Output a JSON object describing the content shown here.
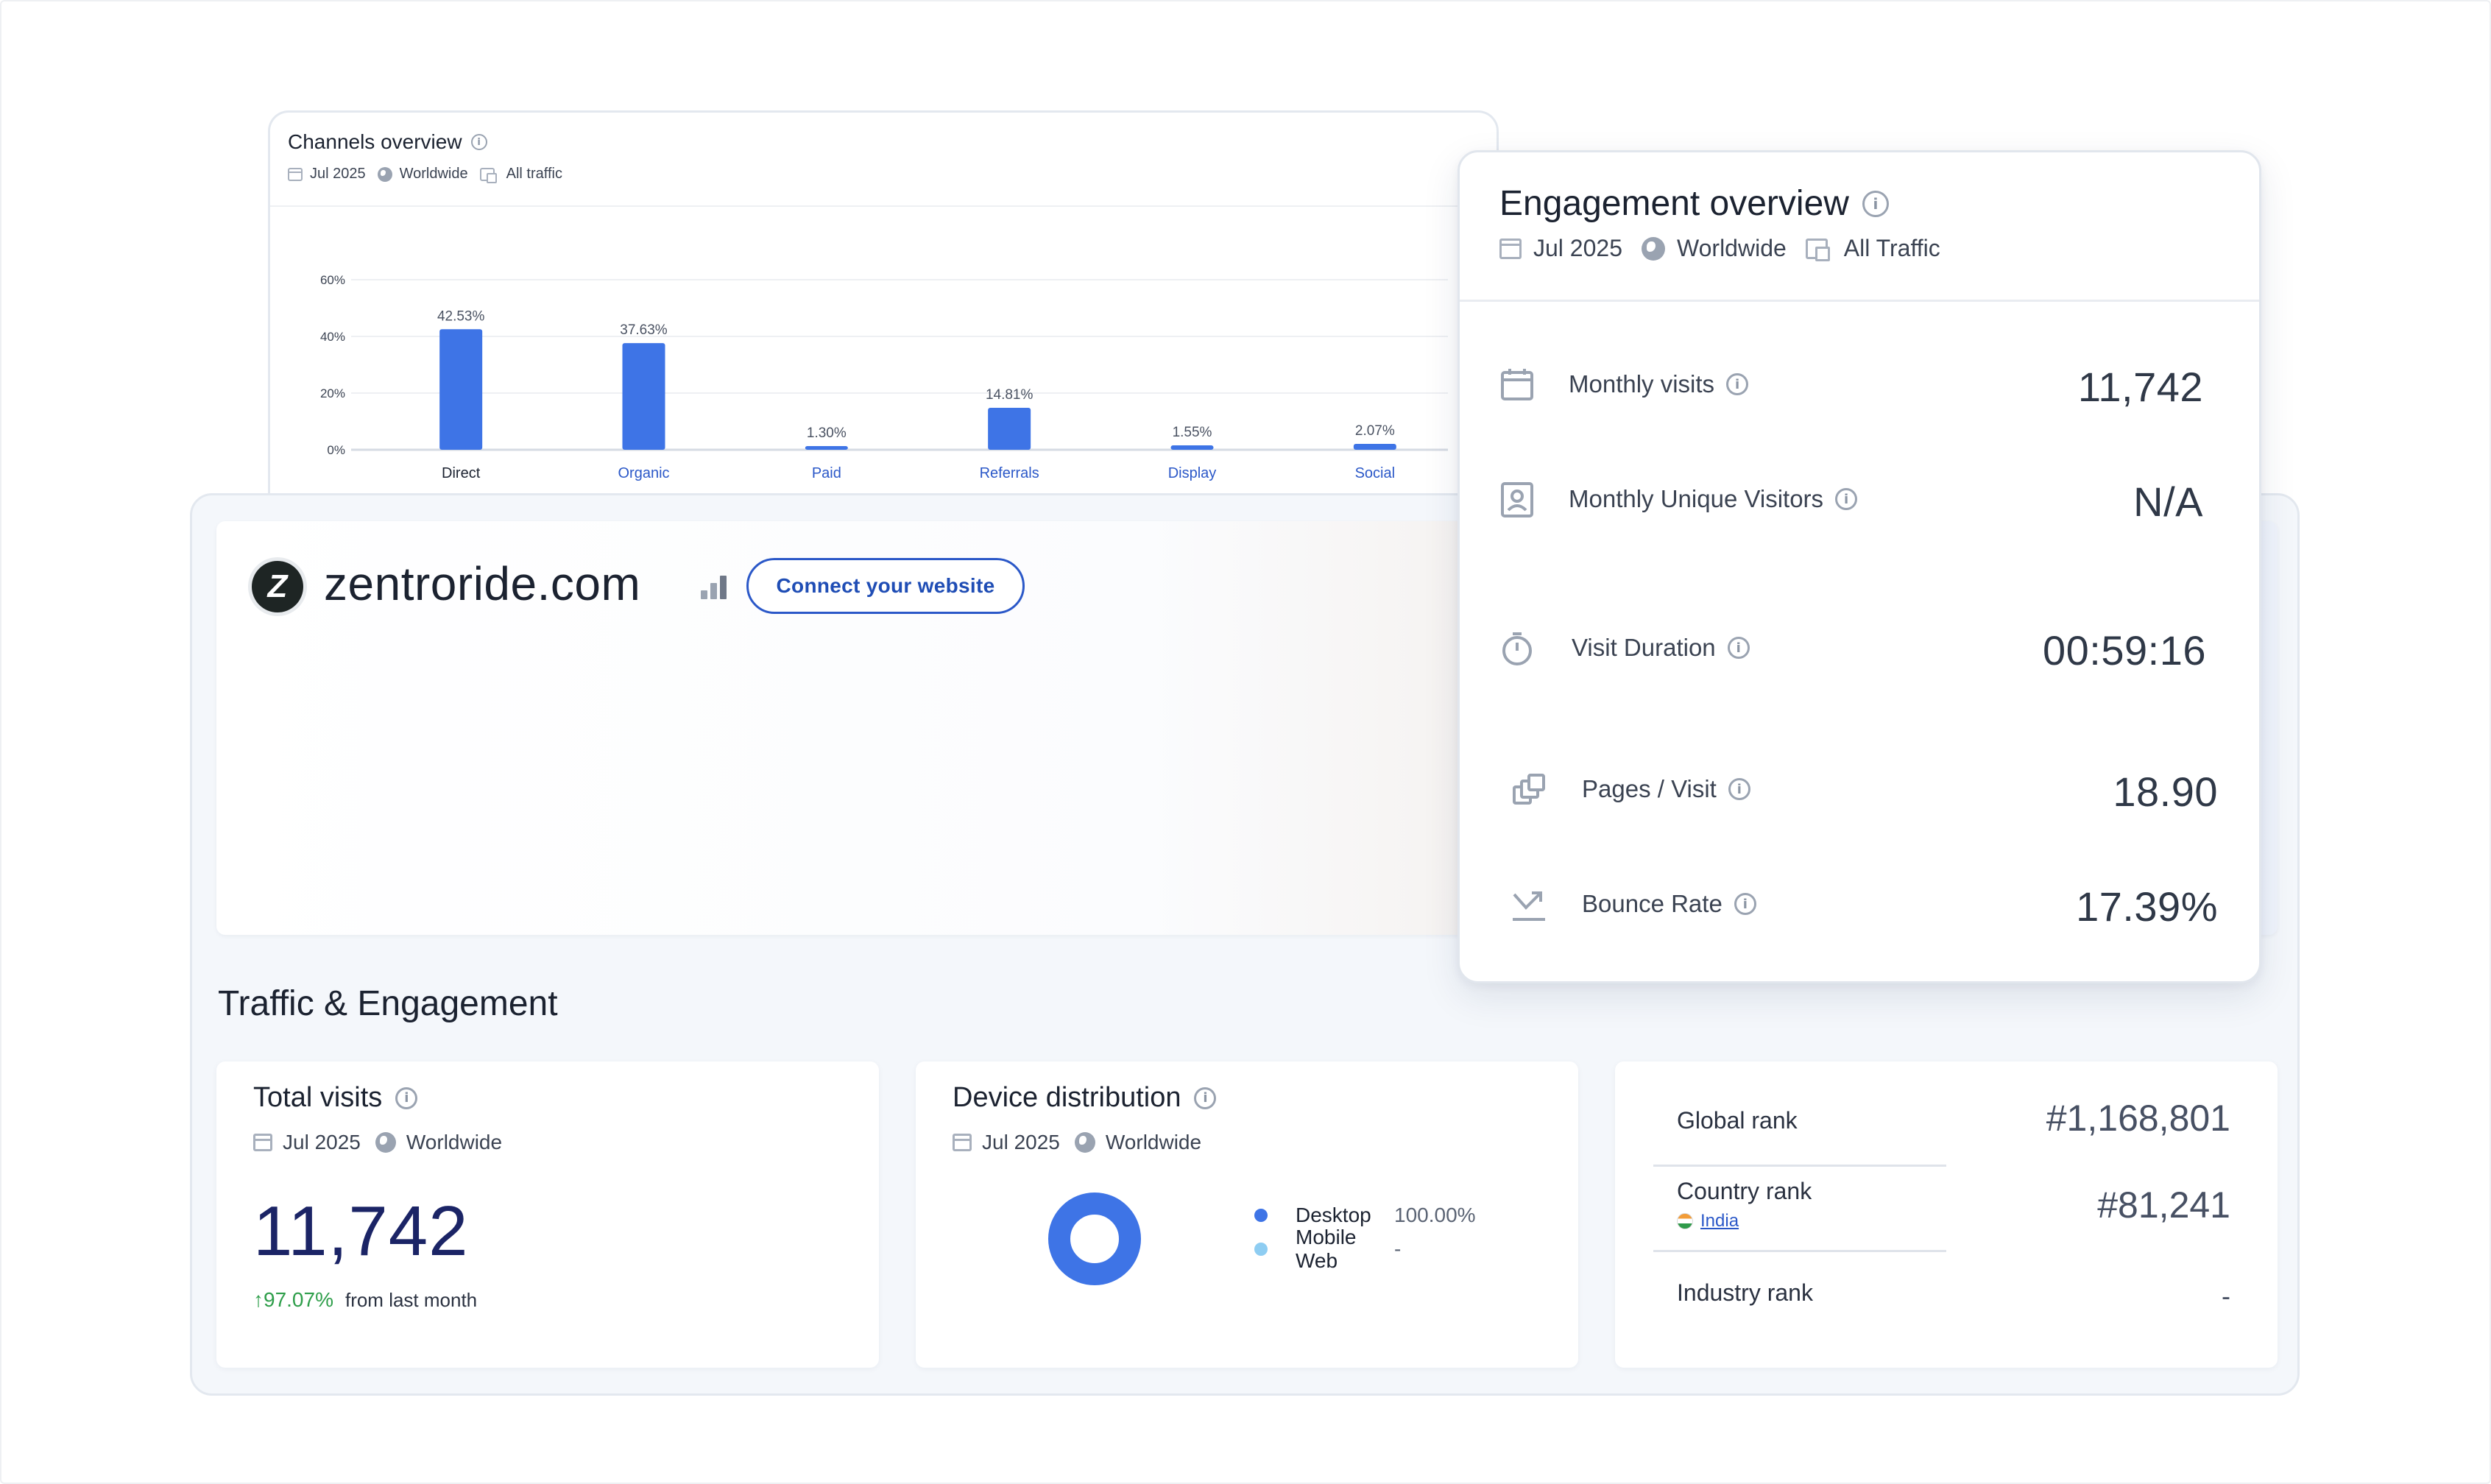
{
  "channels": {
    "title": "Channels overview",
    "meta": {
      "period": "Jul 2025",
      "region": "Worldwide",
      "traffic": "All traffic"
    }
  },
  "chart_data": {
    "type": "bar",
    "categories": [
      "Direct",
      "Organic",
      "Paid",
      "Referrals",
      "Display",
      "Social"
    ],
    "values": [
      42.53,
      37.63,
      1.3,
      14.81,
      1.55,
      2.07
    ],
    "value_labels": [
      "42.53%",
      "37.63%",
      "1.30%",
      "14.81%",
      "1.55%",
      "2.07%"
    ],
    "y_ticks": [
      "0%",
      "20%",
      "40%",
      "60%"
    ],
    "ylim": [
      0,
      60
    ],
    "grid": true,
    "bar_color": "#3e74e6"
  },
  "engagement": {
    "title": "Engagement overview",
    "meta": {
      "period": "Jul 2025",
      "region": "Worldwide",
      "traffic": "All Traffic"
    },
    "metrics": [
      {
        "label": "Monthly visits",
        "value": "11,742",
        "icon": "calendar-icon"
      },
      {
        "label": "Monthly Unique Visitors",
        "value": "N/A",
        "icon": "user-badge-icon"
      },
      {
        "label": "Visit Duration",
        "value": "00:59:16",
        "icon": "stopwatch-icon"
      },
      {
        "label": "Pages / Visit",
        "value": "18.90",
        "icon": "pages-stack-icon"
      },
      {
        "label": "Bounce Rate",
        "value": "17.39%",
        "icon": "bounce-arrow-icon"
      }
    ]
  },
  "site": {
    "name": "zentroride.com",
    "connect_label": "Connect your website"
  },
  "section_title": "Traffic & Engagement",
  "total_visits": {
    "title": "Total visits",
    "meta": {
      "period": "Jul 2025",
      "region": "Worldwide"
    },
    "value": "11,742",
    "delta": "↑97.07%",
    "delta_text": "from last month"
  },
  "device": {
    "title": "Device distribution",
    "meta": {
      "period": "Jul 2025",
      "region": "Worldwide"
    },
    "items": [
      {
        "label": "Desktop",
        "value": "100.00%",
        "color": "#3e74e6"
      },
      {
        "label": "Mobile Web",
        "value": "-",
        "color": "#8ecdf2"
      }
    ]
  },
  "ranks": {
    "global_label": "Global rank",
    "global_value": "#1,168,801",
    "country_label": "Country rank",
    "country_name": "India",
    "country_value": "#81,241",
    "industry_label": "Industry rank",
    "industry_value": "-"
  }
}
